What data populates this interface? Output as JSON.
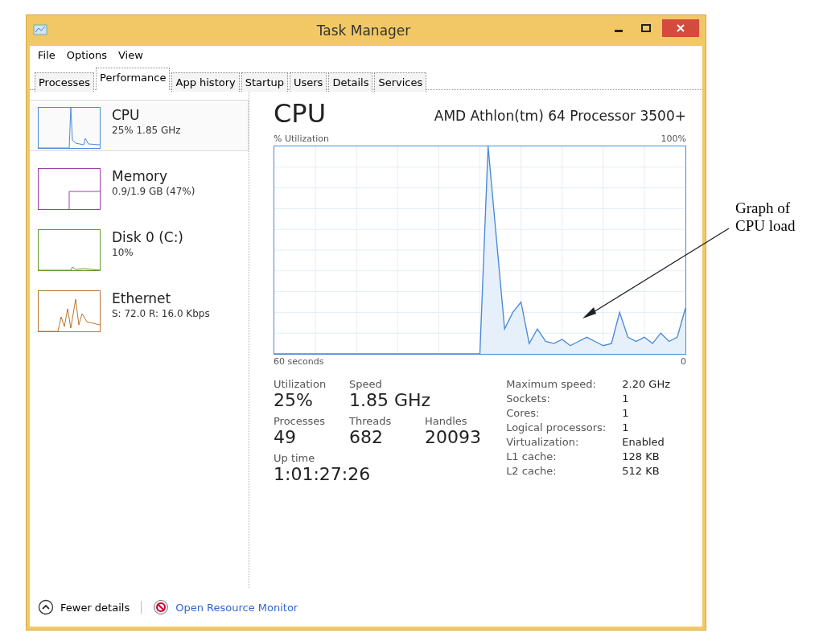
{
  "window": {
    "title": "Task Manager"
  },
  "menu": [
    "File",
    "Options",
    "View"
  ],
  "tabs": [
    {
      "label": "Processes",
      "selected": false
    },
    {
      "label": "Performance",
      "selected": true
    },
    {
      "label": "App history",
      "selected": false
    },
    {
      "label": "Startup",
      "selected": false
    },
    {
      "label": "Users",
      "selected": false
    },
    {
      "label": "Details",
      "selected": false
    },
    {
      "label": "Services",
      "selected": false
    }
  ],
  "sidebar": [
    {
      "name": "CPU",
      "detail": "25% 1.85 GHz",
      "color": "#4a8ad8",
      "selected": true
    },
    {
      "name": "Memory",
      "detail": "0.9/1.9 GB (47%)",
      "color": "#a03cab",
      "selected": false
    },
    {
      "name": "Disk 0 (C:)",
      "detail": "10%",
      "color": "#5f9a2c",
      "selected": false
    },
    {
      "name": "Ethernet",
      "detail": "S: 72.0 R: 16.0 Kbps",
      "color": "#b8742a",
      "selected": false
    }
  ],
  "cpu": {
    "title": "CPU",
    "processor": "AMD Athlon(tm) 64 Processor 3500+",
    "graph_label": "% Utilization",
    "graph_max": "100%",
    "graph_time": "60 seconds",
    "graph_min": "0",
    "stat_rows": [
      [
        {
          "label": "Utilization",
          "value": "25%"
        },
        {
          "label": "Speed",
          "value": "1.85 GHz"
        }
      ],
      [
        {
          "label": "Processes",
          "value": "49"
        },
        {
          "label": "Threads",
          "value": "682"
        },
        {
          "label": "Handles",
          "value": "20093"
        }
      ],
      [
        {
          "label": "Up time",
          "value": "1:01:27:26"
        }
      ]
    ],
    "specs": [
      {
        "label": "Maximum speed:",
        "value": "2.20 GHz"
      },
      {
        "label": "Sockets:",
        "value": "1"
      },
      {
        "label": "Cores:",
        "value": "1"
      },
      {
        "label": "Logical processors:",
        "value": "1"
      },
      {
        "label": "Virtualization:",
        "value": "Enabled"
      },
      {
        "label": "L1 cache:",
        "value": "128 KB"
      },
      {
        "label": "L2 cache:",
        "value": "512 KB"
      }
    ]
  },
  "footer": {
    "fewer_details": "Fewer details",
    "link": "Open Resource Monitor"
  },
  "annotation": "Graph of CPU load"
}
